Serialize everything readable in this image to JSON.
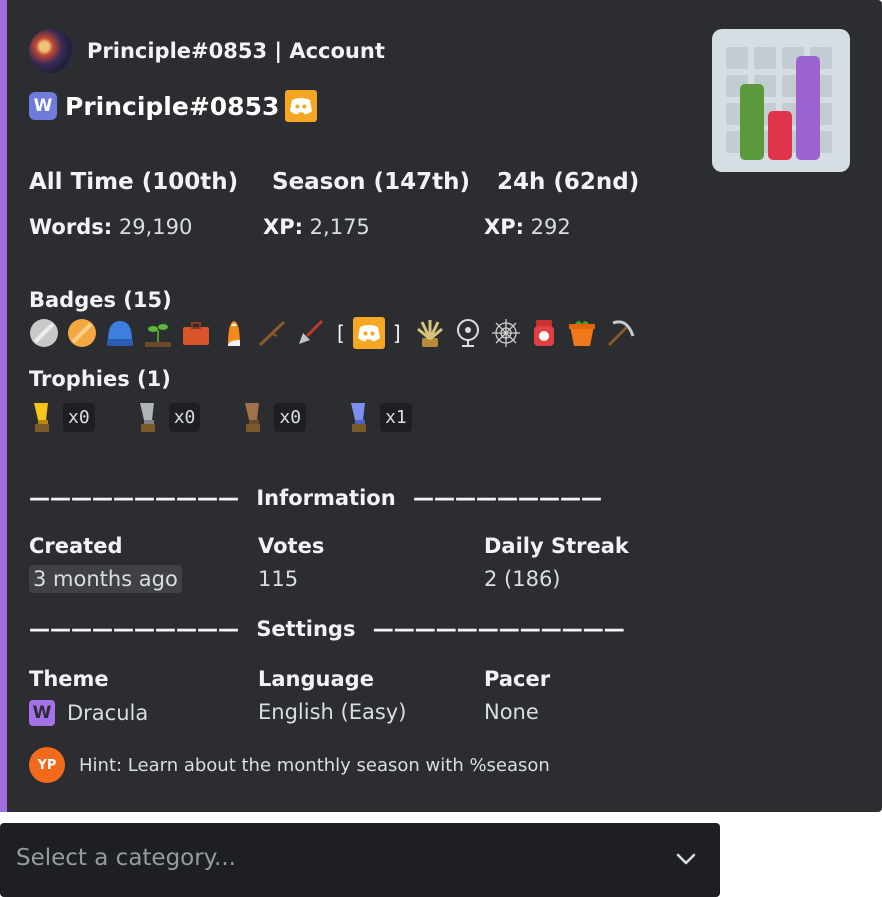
{
  "embed": {
    "accent_color": "#9f6fe0",
    "author": {
      "name": "Principle#0853 | Account"
    },
    "title": {
      "text": "Principle#0853",
      "prefix_icon": "w-icon",
      "suffix_icon": "discord-icon"
    },
    "thumbnail": {
      "icon": "bar-chart-icon"
    },
    "stats": [
      {
        "heading": "All Time (100th)",
        "label": "Words:",
        "value": "29,190"
      },
      {
        "heading": "Season (147th)",
        "label": "XP:",
        "value": "2,175"
      },
      {
        "heading": "24h (62nd)",
        "label": "XP:",
        "value": "292"
      }
    ],
    "badges": {
      "title": "Badges (15)",
      "open_bracket": "[",
      "close_bracket": "]",
      "icons": [
        "silver-coin-icon",
        "gold-coin-icon",
        "beanie-icon",
        "seedling-icon",
        "briefcase-icon",
        "candy-corn-icon",
        "stick-icon",
        "shovel-icon",
        "discord-icon",
        "plant-icon",
        "fan-icon",
        "spiderweb-icon",
        "jar-icon",
        "pot-icon",
        "pickaxe-icon"
      ]
    },
    "trophies": {
      "title": "Trophies (1)",
      "items": [
        {
          "icon": "gold-trophy-icon",
          "count": "x0"
        },
        {
          "icon": "silver-trophy-icon",
          "count": "x0"
        },
        {
          "icon": "bronze-trophy-icon",
          "count": "x0"
        },
        {
          "icon": "blue-trophy-icon",
          "count": "x1"
        }
      ]
    },
    "information": {
      "divider_left": "——————————",
      "title": "Information",
      "divider_right": "—————————",
      "fields": [
        {
          "label": "Created",
          "value": "3 months ago"
        },
        {
          "label": "Votes",
          "value": "115"
        },
        {
          "label": "Daily Streak",
          "value": "2 (186)"
        }
      ]
    },
    "settings": {
      "divider_left": "——————————",
      "title": "Settings",
      "divider_right": "————————————",
      "fields": [
        {
          "label": "Theme",
          "value": "Dracula",
          "icon": "w-icon"
        },
        {
          "label": "Language",
          "value": "English (Easy)"
        },
        {
          "label": "Pacer",
          "value": "None"
        }
      ]
    },
    "footer": {
      "icon_text": "YP",
      "text": "Hint: Learn about the monthly season with %season"
    }
  },
  "select_menu": {
    "placeholder": "Select a category..."
  }
}
